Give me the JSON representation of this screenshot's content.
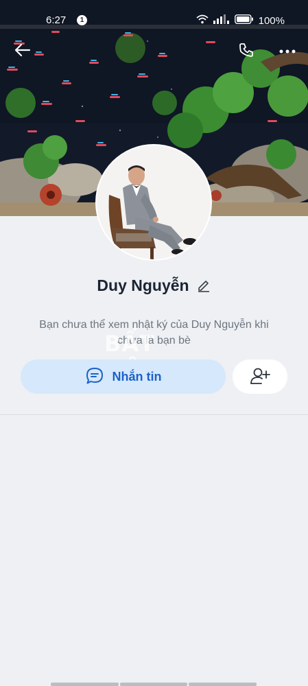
{
  "status_bar": {
    "time": "6:27",
    "notification_count": "1",
    "battery_percent": "100%"
  },
  "header": {
    "icons": [
      "back-arrow-icon",
      "phone-call-icon",
      "more-options-icon"
    ]
  },
  "profile": {
    "name": "Duy Nguyễn",
    "privacy_notice": "Bạn chưa thể xem nhật ký của Duy Nguyễn khi chưa là bạn bè"
  },
  "actions": {
    "message_label": "Nhắn tin",
    "message_icon": "chat-bubble-icon",
    "add_friend_icon": "add-friend-icon"
  },
  "watermark": "BẤT ĐỘT",
  "colors": {
    "accent": "#1a62c9",
    "message_button_bg": "#d6e8fb",
    "page_bg": "#eef0f3"
  }
}
